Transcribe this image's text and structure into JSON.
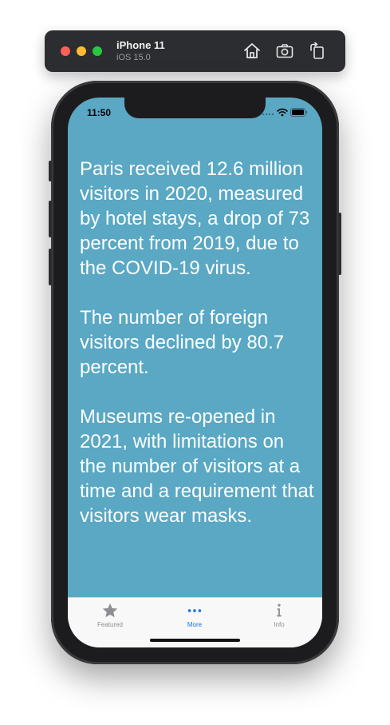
{
  "simulator": {
    "device_name": "iPhone 11",
    "os_version": "iOS 15.0",
    "icons": [
      "home-icon",
      "screenshot-icon",
      "rotate-icon"
    ]
  },
  "status_bar": {
    "time": "11:50",
    "icons": [
      "signal-icon",
      "wifi-icon",
      "battery-icon"
    ]
  },
  "content": {
    "paragraphs": [
      "Paris received 12.6 million visitors in 2020, measured by hotel stays, a drop of 73 percent from 2019, due to the COVID-19 virus.",
      "The number of foreign visitors declined by 80.7 percent.",
      "Museums re-opened in 2021, with limitations on the number of visitors at a time and a requirement that visitors wear masks."
    ]
  },
  "tab_bar": {
    "tabs": [
      {
        "label": "Featured",
        "icon": "star-icon",
        "selected": false
      },
      {
        "label": "More",
        "icon": "more-icon",
        "selected": true
      },
      {
        "label": "Info",
        "icon": "info-icon",
        "selected": false
      }
    ]
  },
  "colors": {
    "screen_background": "#5aa8c3",
    "text": "#ffffff",
    "tab_selected": "#1a73e8",
    "tab_unselected": "#8e8e93",
    "toolbar": "#2b2d30"
  }
}
